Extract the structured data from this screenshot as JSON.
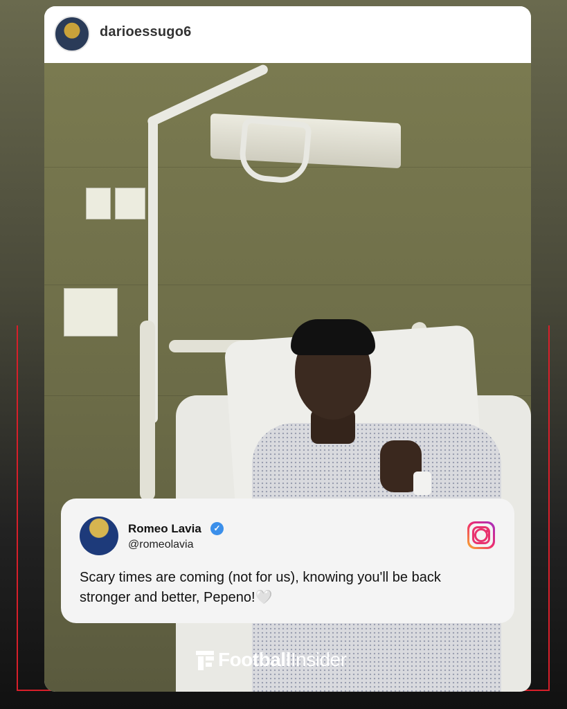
{
  "post": {
    "username": "darioessugo6"
  },
  "comment": {
    "name": "Romeo Lavia",
    "handle": "@romeolavia",
    "text": "Scary times are coming (not for us), knowing you'll be back stronger and better, Pepeno!🤍",
    "verified_icon": "verified-badge-icon",
    "platform_icon": "instagram-icon"
  },
  "brand": {
    "part1": "Football",
    "part2": "Insider",
    "icon": "footballinsider-logo-icon"
  },
  "colors": {
    "frame_accent": "#d81f2a",
    "verified": "#3b8fea"
  }
}
